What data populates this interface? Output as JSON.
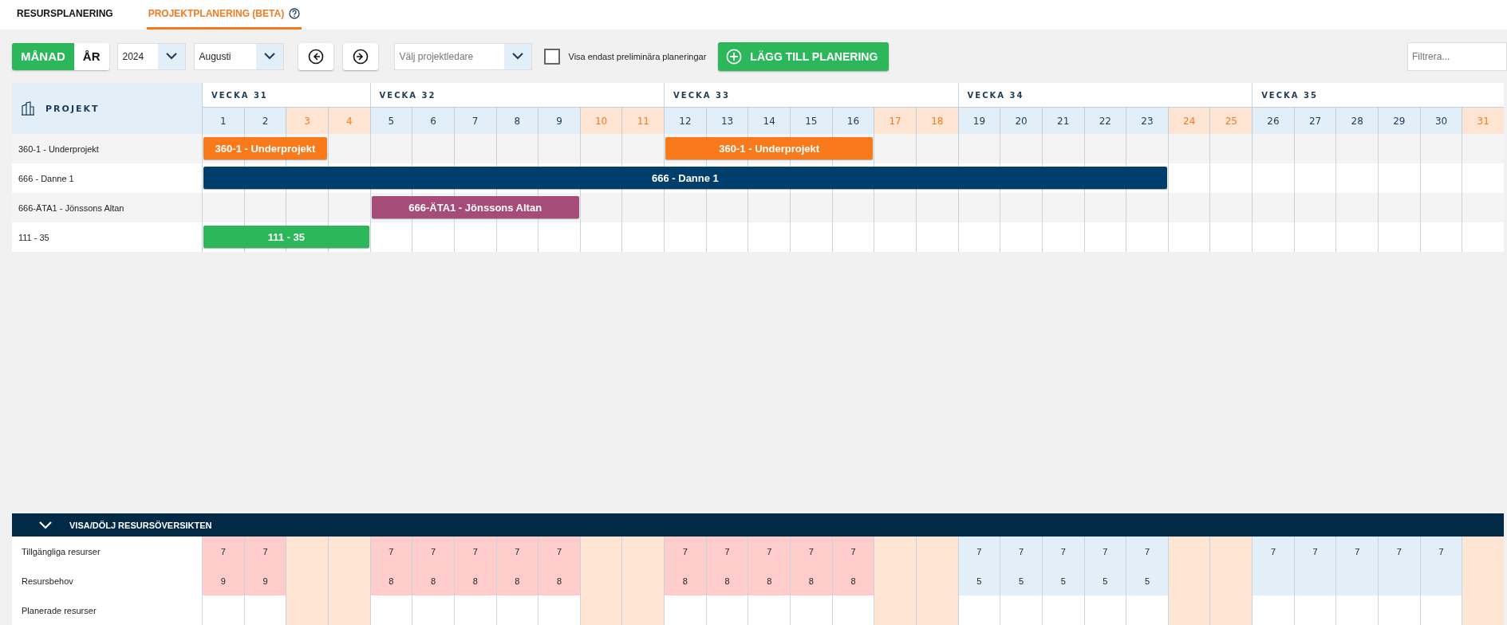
{
  "tabs": [
    {
      "label": "RESURSPLANERING",
      "selected": false,
      "help": false
    },
    {
      "label": "PROJEKTPLANERING (BETA)",
      "selected": true,
      "help": true
    }
  ],
  "toolbar": {
    "period_toggle": [
      {
        "label": "MÅNAD",
        "selected": true
      },
      {
        "label": "ÅR",
        "selected": false
      }
    ],
    "year": "2024",
    "month": "Augusti",
    "project_lead": {
      "placeholder": "Välj projektledare"
    },
    "preliminary_only": {
      "label": "Visa endast preliminära planeringar",
      "checked": false
    },
    "add_button": "LÄGG TILL PLANERING",
    "filter": {
      "placeholder": "Filtrera..."
    }
  },
  "project_column": "PROJEKT",
  "weeks": [
    {
      "label": "VECKA 31",
      "days": [
        {
          "label": "1",
          "kind": "over",
          "available": "7",
          "need": "9"
        },
        {
          "label": "2",
          "kind": "over",
          "available": "7",
          "need": "9"
        },
        {
          "label": "3",
          "kind": "weekend"
        },
        {
          "label": "4",
          "kind": "weekend"
        }
      ]
    },
    {
      "label": "VECKA 32",
      "days": [
        {
          "label": "5",
          "kind": "over",
          "available": "7",
          "need": "8"
        },
        {
          "label": "6",
          "kind": "over",
          "available": "7",
          "need": "8"
        },
        {
          "label": "7",
          "kind": "over",
          "available": "7",
          "need": "8"
        },
        {
          "label": "8",
          "kind": "over",
          "available": "7",
          "need": "8"
        },
        {
          "label": "9",
          "kind": "over",
          "available": "7",
          "need": "8"
        },
        {
          "label": "10",
          "kind": "weekend"
        },
        {
          "label": "11",
          "kind": "weekend"
        }
      ]
    },
    {
      "label": "VECKA 33",
      "days": [
        {
          "label": "12",
          "kind": "over",
          "available": "7",
          "need": "8"
        },
        {
          "label": "13",
          "kind": "over",
          "available": "7",
          "need": "8"
        },
        {
          "label": "14",
          "kind": "over",
          "available": "7",
          "need": "8"
        },
        {
          "label": "15",
          "kind": "over",
          "available": "7",
          "need": "8"
        },
        {
          "label": "16",
          "kind": "over",
          "available": "7",
          "need": "8"
        },
        {
          "label": "17",
          "kind": "weekend"
        },
        {
          "label": "18",
          "kind": "weekend"
        }
      ]
    },
    {
      "label": "VECKA 34",
      "days": [
        {
          "label": "19",
          "kind": "ok",
          "available": "7",
          "need": "5"
        },
        {
          "label": "20",
          "kind": "ok",
          "available": "7",
          "need": "5"
        },
        {
          "label": "21",
          "kind": "ok",
          "available": "7",
          "need": "5"
        },
        {
          "label": "22",
          "kind": "ok",
          "available": "7",
          "need": "5"
        },
        {
          "label": "23",
          "kind": "ok",
          "available": "7",
          "need": "5"
        },
        {
          "label": "24",
          "kind": "weekend"
        },
        {
          "label": "25",
          "kind": "weekend"
        }
      ]
    },
    {
      "label": "VECKA 35",
      "days": [
        {
          "label": "26",
          "kind": "ok",
          "available": "7"
        },
        {
          "label": "27",
          "kind": "ok",
          "available": "7"
        },
        {
          "label": "28",
          "kind": "ok",
          "available": "7"
        },
        {
          "label": "29",
          "kind": "ok",
          "available": "7"
        },
        {
          "label": "30",
          "kind": "ok",
          "available": "7"
        },
        {
          "label": "31",
          "kind": "weekend"
        }
      ]
    }
  ],
  "projects": [
    {
      "name": "360-1 - Underprojekt",
      "track": [
        {
          "kind": "bar",
          "label": "360-1 - Underprojekt",
          "color": "#f97a1a"
        },
        {
          "kind": "more"
        },
        {
          "kind": "more"
        },
        {
          "kind": "gap"
        },
        {
          "kind": "gap"
        },
        {
          "kind": "gap"
        },
        {
          "kind": "gap"
        },
        {
          "kind": "gap"
        },
        {
          "kind": "gap"
        },
        {
          "kind": "gap"
        },
        {
          "kind": "gap"
        },
        {
          "kind": "bar",
          "label": "360-1 - Underprojekt",
          "color": "#f97a1a"
        },
        {
          "kind": "more"
        },
        {
          "kind": "more"
        },
        {
          "kind": "more"
        },
        {
          "kind": "more"
        },
        {
          "kind": "gap"
        },
        {
          "kind": "gap"
        },
        {
          "kind": "gap"
        },
        {
          "kind": "gap"
        },
        {
          "kind": "gap"
        },
        {
          "kind": "gap"
        },
        {
          "kind": "gap"
        },
        {
          "kind": "gap"
        },
        {
          "kind": "gap"
        },
        {
          "kind": "gap"
        },
        {
          "kind": "gap"
        },
        {
          "kind": "gap"
        },
        {
          "kind": "gap"
        },
        {
          "kind": "gap"
        },
        {
          "kind": "gap"
        }
      ]
    },
    {
      "name": "666 - Danne 1",
      "track": [
        {
          "kind": "bar",
          "label": "666 - Danne 1",
          "color": "#003f6b"
        },
        {
          "kind": "more"
        },
        {
          "kind": "more"
        },
        {
          "kind": "more"
        },
        {
          "kind": "more"
        },
        {
          "kind": "more"
        },
        {
          "kind": "more"
        },
        {
          "kind": "more"
        },
        {
          "kind": "more"
        },
        {
          "kind": "more"
        },
        {
          "kind": "more"
        },
        {
          "kind": "more"
        },
        {
          "kind": "more"
        },
        {
          "kind": "more"
        },
        {
          "kind": "more"
        },
        {
          "kind": "more"
        },
        {
          "kind": "more"
        },
        {
          "kind": "more"
        },
        {
          "kind": "more"
        },
        {
          "kind": "more"
        },
        {
          "kind": "more"
        },
        {
          "kind": "more"
        },
        {
          "kind": "more"
        },
        {
          "kind": "gap"
        },
        {
          "kind": "gap"
        },
        {
          "kind": "gap"
        },
        {
          "kind": "gap"
        },
        {
          "kind": "gap"
        },
        {
          "kind": "gap"
        },
        {
          "kind": "gap"
        },
        {
          "kind": "gap"
        }
      ]
    },
    {
      "name": "666-ÄTA1 - Jönssons Altan",
      "track": [
        {
          "kind": "gap"
        },
        {
          "kind": "gap"
        },
        {
          "kind": "gap"
        },
        {
          "kind": "gap"
        },
        {
          "kind": "bar",
          "label": "666-ÄTA1 - Jönssons Altan",
          "color": "#a54c78"
        },
        {
          "kind": "more"
        },
        {
          "kind": "more"
        },
        {
          "kind": "more"
        },
        {
          "kind": "more"
        },
        {
          "kind": "gap"
        },
        {
          "kind": "gap"
        },
        {
          "kind": "gap"
        },
        {
          "kind": "gap"
        },
        {
          "kind": "gap"
        },
        {
          "kind": "gap"
        },
        {
          "kind": "gap"
        },
        {
          "kind": "gap"
        },
        {
          "kind": "gap"
        },
        {
          "kind": "gap"
        },
        {
          "kind": "gap"
        },
        {
          "kind": "gap"
        },
        {
          "kind": "gap"
        },
        {
          "kind": "gap"
        },
        {
          "kind": "gap"
        },
        {
          "kind": "gap"
        },
        {
          "kind": "gap"
        },
        {
          "kind": "gap"
        },
        {
          "kind": "gap"
        },
        {
          "kind": "gap"
        },
        {
          "kind": "gap"
        },
        {
          "kind": "gap"
        }
      ]
    },
    {
      "name": "111 - 35",
      "track": [
        {
          "kind": "bar",
          "label": "111 - 35",
          "color": "#2bb75a"
        },
        {
          "kind": "more"
        },
        {
          "kind": "more"
        },
        {
          "kind": "more"
        },
        {
          "kind": "gap"
        },
        {
          "kind": "gap"
        },
        {
          "kind": "gap"
        },
        {
          "kind": "gap"
        },
        {
          "kind": "gap"
        },
        {
          "kind": "gap"
        },
        {
          "kind": "gap"
        },
        {
          "kind": "gap"
        },
        {
          "kind": "gap"
        },
        {
          "kind": "gap"
        },
        {
          "kind": "gap"
        },
        {
          "kind": "gap"
        },
        {
          "kind": "gap"
        },
        {
          "kind": "gap"
        },
        {
          "kind": "gap"
        },
        {
          "kind": "gap"
        },
        {
          "kind": "gap"
        },
        {
          "kind": "gap"
        },
        {
          "kind": "gap"
        },
        {
          "kind": "gap"
        },
        {
          "kind": "gap"
        },
        {
          "kind": "gap"
        },
        {
          "kind": "gap"
        },
        {
          "kind": "gap"
        },
        {
          "kind": "gap"
        },
        {
          "kind": "gap"
        },
        {
          "kind": "gap"
        }
      ]
    }
  ],
  "resources": {
    "toggle": "VISA/DÖLJ RESURSÖVERSIKTEN",
    "expanded": true,
    "rows": [
      {
        "label": "Tillgängliga resurser",
        "kind": "available"
      },
      {
        "label": "Resursbehov",
        "kind": "need"
      },
      {
        "label": "Planerade resurser",
        "kind": "planned"
      }
    ]
  }
}
